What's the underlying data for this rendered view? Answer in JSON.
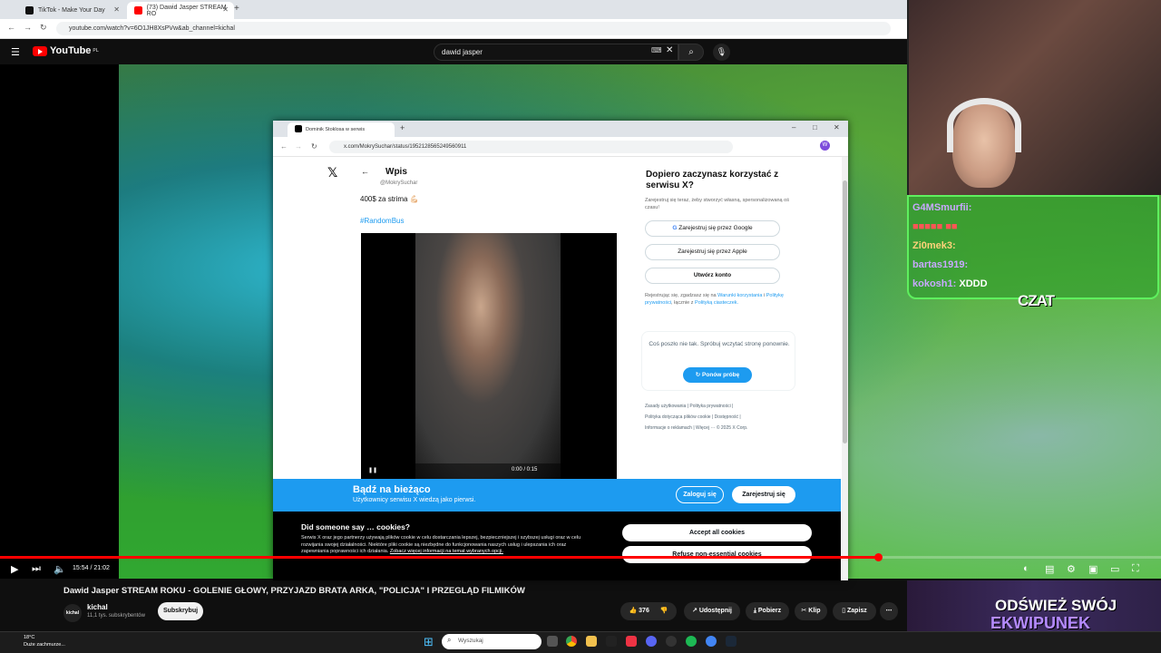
{
  "browser": {
    "tabs": [
      {
        "title": "TikTok - Make Your Day",
        "active": false
      },
      {
        "title": "(73) Dawid Jasper STREAM RO",
        "active": true
      }
    ],
    "url": "youtube.com/watch?v=6O1JH8XsPVw&ab_channel=kichal"
  },
  "youtube": {
    "logo": "YouTube",
    "region": "PL",
    "search_value": "dawid jasper",
    "video_title": "Dawid Jasper STREAM ROKU - GOLENIE GŁOWY, PRZYJAZD BRATA ARKA, \"POLICJA\" I PRZEGLĄD FILMIKÓW",
    "channel": {
      "avatar": "kichal",
      "name": "kichal",
      "subs": "11,1 tys. subskrybentów",
      "subscribe": "Subskrybuj"
    },
    "actions": {
      "likes": "376",
      "share": "Udostępnij",
      "download": "Pobierz",
      "clip": "Klip",
      "save": "Zapisz"
    },
    "player": {
      "time": "15:54 / 21:02",
      "progress": 0.756
    }
  },
  "stream": {
    "chat": [
      {
        "user": "G4MSmurfii:",
        "msg": ""
      },
      {
        "user": "Zi0mek3:",
        "msg": ""
      },
      {
        "user": "bartas1919:",
        "msg": ""
      },
      {
        "user": "kokosh1:",
        "msg": "XDDD"
      }
    ],
    "chat_label": "Czat",
    "promo_line1": "ODŚWIEŻ SWÓJ",
    "promo_line2": "EKWIPUNEK"
  },
  "x_window": {
    "tab_title": "Dominik Stoklosa w serwis",
    "url": "x.com/MokrySuchar/status/1952128565249560911",
    "header": "Wpis",
    "handle": "@MokrySuchar",
    "tweet_text": "400$ za strima 💪🏻",
    "hashtag": "#RandomBus",
    "video_time": "0:00 / 0:15",
    "signup_title": "Dopiero zaczynasz korzystać z serwisu X?",
    "signup_sub": "Zarejestruj się teraz, żeby stworzyć własną, spersonalizowaną oś czasu!",
    "google_btn": "Zarejestruj się przez Google",
    "apple_btn": "Zarejestruj się przez Apple",
    "create_btn": "Utwórz konto",
    "terms_prefix": "Rejestrując się, zgadzasz się na",
    "terms_link1": "Warunki korzystania",
    "terms_mid": "i",
    "terms_link2": "Politykę prywatności",
    "terms_mid2": ", łącznie z",
    "terms_link3": "Polityką ciasteczek.",
    "error_text": "Coś poszło nie tak. Spróbuj wczytać stronę ponownie.",
    "retry": "Ponów próbę",
    "footer": [
      "Zasady użytkowania",
      "Polityka prywatności",
      "Polityka dotycząca plików cookie",
      "Dostępność",
      "Informacje o reklamach",
      "Więcej ···",
      "© 2025 X Corp."
    ],
    "banner_title": "Bądź na bieżąco",
    "banner_sub": "Użytkownicy serwisu X wiedzą jako pierwsi.",
    "login": "Zaloguj się",
    "register": "Zarejestruj się",
    "cookie_title": "Did someone say … cookies?",
    "cookie_body": "Serwis X oraz jego partnerzy używają plików cookie w celu dostarczania lepszej, bezpieczniejszej i szybszej usługi oraz w celu rozwijania swojej działalności. Niektóre pliki cookie są niezbędne do funkcjonowania naszych usług i ulepszania ich oraz zapewniania poprawności ich działania.",
    "cookie_link": "Zobacz więcej informacji na temat wybranych opcji.",
    "accept": "Accept all cookies",
    "refuse": "Refuse non-essential cookies"
  },
  "taskbar": {
    "temp": "18°C",
    "weather": "Duże zachmurze...",
    "search": "Wyszukaj"
  }
}
